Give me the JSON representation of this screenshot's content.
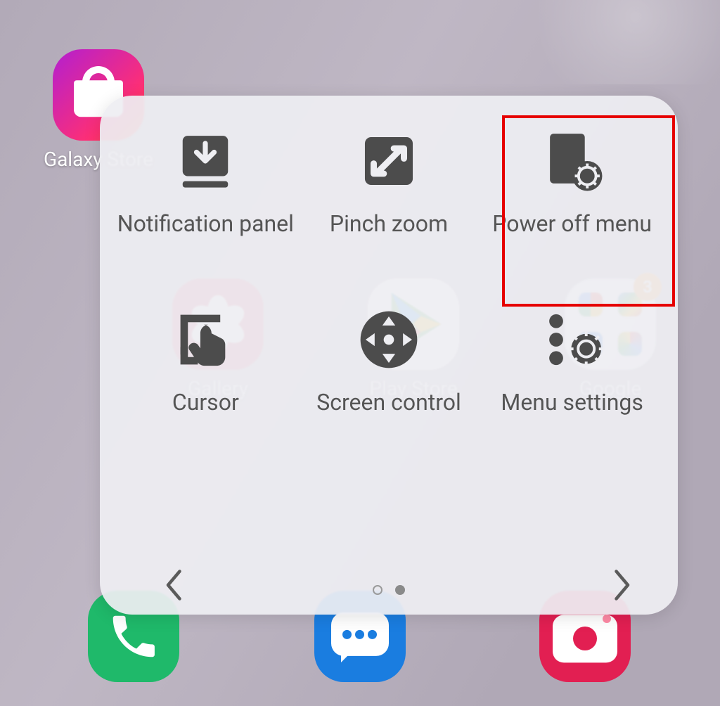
{
  "home": {
    "apps": {
      "store": {
        "label": "Galaxy Store"
      },
      "gallery": {
        "label": "Gallery"
      },
      "play": {
        "label": "Play Store"
      },
      "google": {
        "label": "Google",
        "badge": "3"
      }
    }
  },
  "menu": {
    "items": [
      {
        "id": "notification-panel",
        "label": "Notification panel"
      },
      {
        "id": "pinch-zoom",
        "label": "Pinch zoom"
      },
      {
        "id": "power-off-menu",
        "label": "Power off menu"
      },
      {
        "id": "cursor",
        "label": "Cursor"
      },
      {
        "id": "screen-control",
        "label": "Screen control"
      },
      {
        "id": "menu-settings",
        "label": "Menu settings"
      }
    ],
    "page_index": 1,
    "page_count": 2,
    "highlight_item": "power-off-menu"
  },
  "colors": {
    "panel_bg": "#eeeef2",
    "icon_fill": "#4c4c4c",
    "highlight": "#e60000",
    "badge": "#ff9a2e"
  }
}
